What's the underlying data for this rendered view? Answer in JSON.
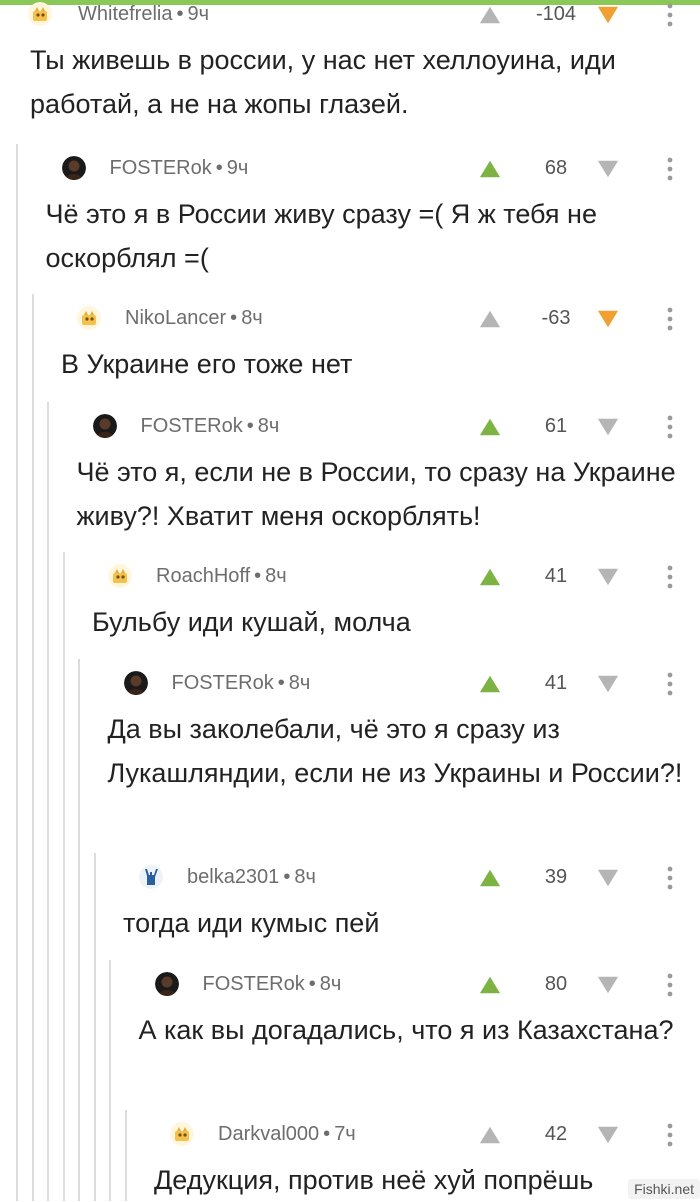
{
  "colors": {
    "accent": "#8ac858",
    "vote_up_active": "#7cb342",
    "vote_down_active": "#f0a030",
    "vote_inactive": "#b5b5b5",
    "thread_line": "#dcdcdc",
    "meta_text": "#6d6d6d"
  },
  "comments": [
    {
      "author": "Whitefrelia",
      "time": "9ч",
      "rating": "-104",
      "text": "Ты живешь в россии, у нас нет хеллоуина, иди работай, а не на жопы глазей.",
      "avatar": "default-avatar-icon",
      "voted": "down",
      "depth": 0
    },
    {
      "author": "FOSTERok",
      "time": "9ч",
      "rating": "68",
      "text": "Чё это я в России живу сразу =( Я ж тебя не оскорблял =(",
      "avatar": "person-avatar-icon",
      "voted": "up",
      "depth": 1
    },
    {
      "author": "NikoLancer",
      "time": "8ч",
      "rating": "-63",
      "text": "В Украине его тоже нет",
      "avatar": "default-avatar-icon",
      "voted": "down",
      "depth": 2
    },
    {
      "author": "FOSTERok",
      "time": "8ч",
      "rating": "61",
      "text": "Чё это я, если не в России, то сразу на Украине живу?! Хватит меня оскорблять!",
      "avatar": "person-avatar-icon",
      "voted": "up",
      "depth": 3
    },
    {
      "author": "RoachHoff",
      "time": "8ч",
      "rating": "41",
      "text": "Бульбу иди кушай, молча",
      "avatar": "default-avatar-icon",
      "voted": "up",
      "depth": 4
    },
    {
      "author": "FOSTERok",
      "time": "8ч",
      "rating": "41",
      "text": "Да вы заколебали, чё это я сразу из Лукашляндии, если не из Украины и России?!",
      "avatar": "person-avatar-icon",
      "voted": "up",
      "depth": 5
    },
    {
      "author": "belka2301",
      "time": "8ч",
      "rating": "39",
      "text": "тогда иди кумыс пей",
      "avatar": "rock-hand-avatar-icon",
      "voted": "up",
      "depth": 6
    },
    {
      "author": "FOSTERok",
      "time": "8ч",
      "rating": "80",
      "text": "А как вы догадались, что я из Казахстана?",
      "avatar": "person-avatar-icon",
      "voted": "up",
      "depth": 7
    },
    {
      "author": "Darkval000",
      "time": "7ч",
      "rating": "42",
      "text": "Дедукция, против неё хуй попрёшь",
      "avatar": "default-avatar-icon",
      "voted": "none",
      "depth": 8
    }
  ],
  "watermark": "Fishki.net"
}
